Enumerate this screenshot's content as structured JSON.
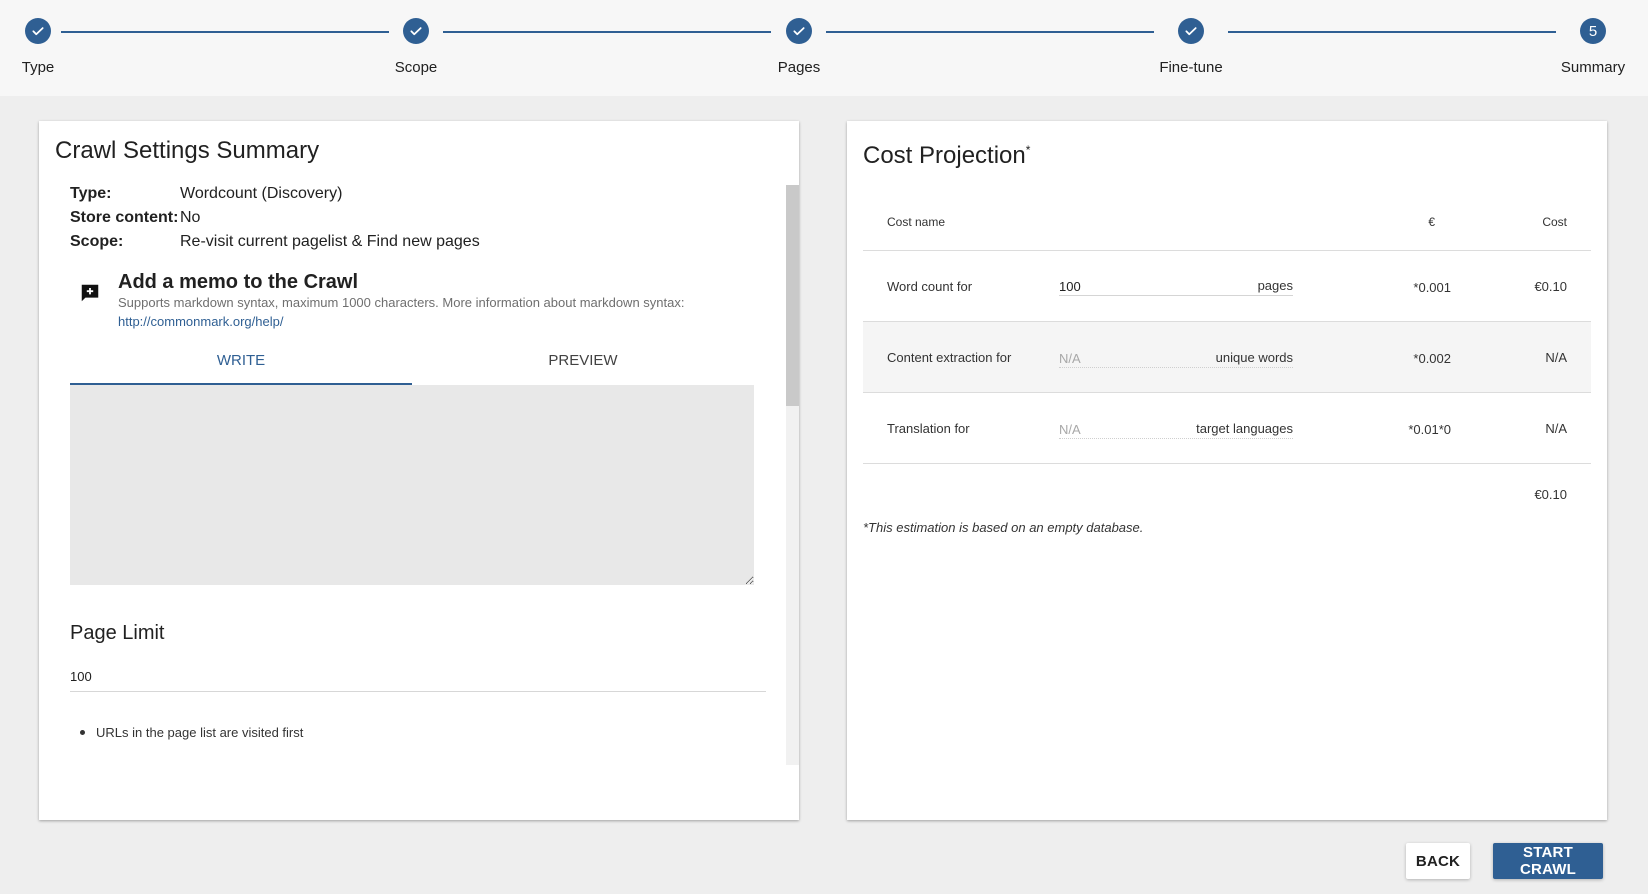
{
  "stepper": {
    "steps": [
      {
        "label": "Type",
        "state": "done",
        "icon": "check-icon"
      },
      {
        "label": "Scope",
        "state": "done",
        "icon": "check-icon"
      },
      {
        "label": "Pages",
        "state": "done",
        "icon": "check-icon"
      },
      {
        "label": "Fine-tune",
        "state": "done",
        "icon": "check-icon"
      },
      {
        "label": "Summary",
        "state": "active",
        "number": "5"
      }
    ]
  },
  "summary": {
    "title": "Crawl Settings Summary",
    "rows": [
      {
        "key": "Type:",
        "value": "Wordcount (Discovery)"
      },
      {
        "key": "Store content:",
        "value": "No"
      },
      {
        "key": "Scope:",
        "value": "Re-visit current pagelist & Find new pages"
      }
    ],
    "memo": {
      "icon": "add-comment-icon",
      "title": "Add a memo to the Crawl",
      "help": "Supports markdown syntax, maximum 1000 characters. More information about markdown syntax:",
      "link": "http://commonmark.org/help/",
      "tabs": [
        "WRITE",
        "PREVIEW"
      ],
      "active_tab": "WRITE",
      "value": ""
    },
    "page_limit": {
      "title": "Page Limit",
      "value": "100",
      "bullets": [
        "URLs in the page list are visited first"
      ]
    }
  },
  "cost": {
    "title": "Cost Projection",
    "title_mark": "*",
    "headers": {
      "name": "Cost name",
      "eur": "€",
      "cost": "Cost"
    },
    "rows": [
      {
        "name": "Word count for",
        "qty_value": "100",
        "qty_placeholder": "",
        "unit": "pages",
        "eur": "*0.001",
        "cost": "€0.10"
      },
      {
        "name": "Content extraction for",
        "qty_value": "",
        "qty_placeholder": "N/A",
        "unit": "unique words",
        "eur": "*0.002",
        "cost": "N/A"
      },
      {
        "name": "Translation for",
        "qty_value": "",
        "qty_placeholder": "N/A",
        "unit": "target languages",
        "eur": "*0.01*0",
        "cost": "N/A"
      }
    ],
    "total": "€0.10",
    "note": "*This estimation is based on an empty database."
  },
  "actions": {
    "back": "BACK",
    "start": "START CRAWL"
  },
  "colors": {
    "primary": "#2f5f93",
    "background": "#eeeeee",
    "stepper_bg": "#f7f7f7",
    "row_shade": "#f5f5f5"
  }
}
